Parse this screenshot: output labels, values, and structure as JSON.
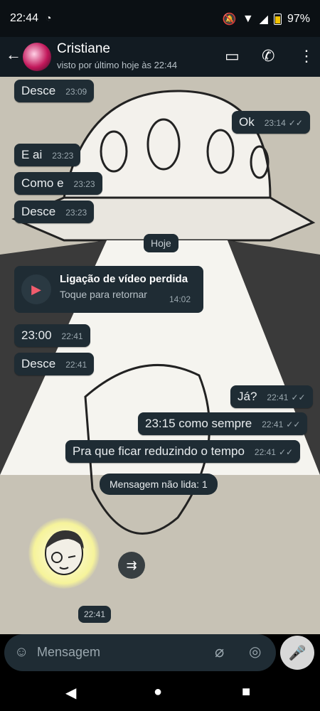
{
  "statusbar": {
    "time": "22:44",
    "battery": "97%",
    "wa_icon": "whatsapp-icon"
  },
  "header": {
    "name": "Cristiane",
    "status": "visto por último hoje às 22:44"
  },
  "messages": [
    {
      "text": "Desce",
      "time": "23:09"
    },
    {
      "text": "Ok",
      "time": "23:14"
    },
    {
      "text": "E ai",
      "time": "23:23"
    },
    {
      "text": "Como e",
      "time": "23:23"
    },
    {
      "text": "Desce",
      "time": "23:23"
    },
    {
      "text": "23:00",
      "time": "22:41"
    },
    {
      "text": "Desce",
      "time": "22:41"
    },
    {
      "text": "Já?",
      "time": "22:41"
    },
    {
      "text": "23:15 como sempre",
      "time": "22:41"
    },
    {
      "text": "Pra que ficar reduzindo o tempo",
      "time": "22:41"
    }
  ],
  "date_chip": "Hoje",
  "call": {
    "title": "Ligação de vídeo perdida",
    "subtitle": "Toque para retornar",
    "time": "14:02"
  },
  "unread": "Mensagem não lida: 1",
  "sticker_time": "22:41",
  "input": {
    "placeholder": "Mensagem"
  },
  "ticks": "✓✓"
}
